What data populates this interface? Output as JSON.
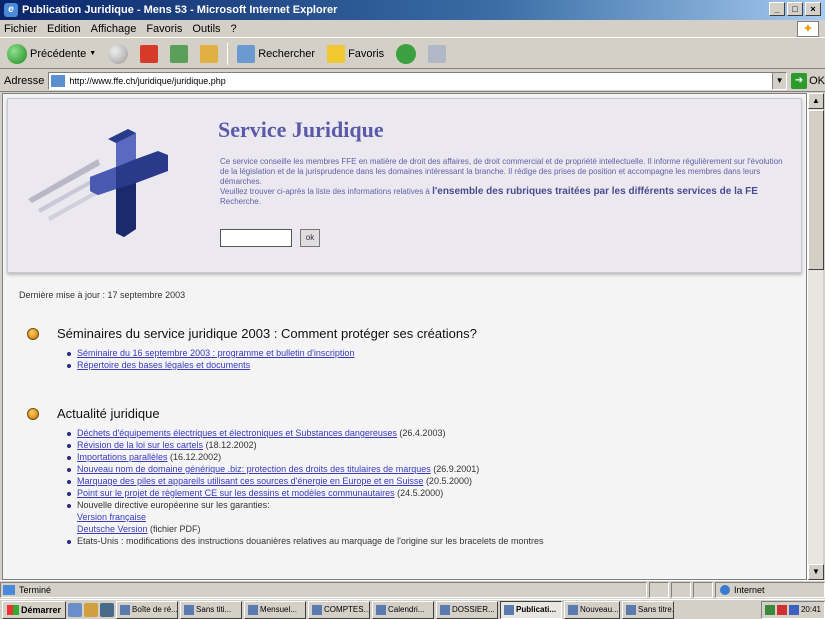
{
  "window": {
    "title": "Publication Juridique - Mens 53 - Microsoft Internet Explorer",
    "buttons": [
      "_",
      "□",
      "×"
    ]
  },
  "menubar": {
    "items": [
      "Fichier",
      "Edition",
      "Affichage",
      "Favoris",
      "Outils",
      "?"
    ]
  },
  "toolbar": {
    "back_label": "Précédente",
    "search_label": "Rechercher",
    "favorites_label": "Favoris"
  },
  "address": {
    "label": "Adresse",
    "url": "http://www.ffe.ch/juridique/juridique.php",
    "go_label": "OK"
  },
  "page": {
    "service_title": "Service Juridique",
    "intro_text": "Ce service conseille les membres FFE en matière de droit des affaires, de droit commercial et de propriété intellectuelle. Il informe régulièrement sur l'évolution de la législation et de la jurisprudence dans les domaines intéressant la branche. Il rédige des prises de position et accompagne les membres dans leurs démarches.",
    "intro_text2": "Veuillez trouver ci-après la liste des informations relatives à",
    "intro_bold": "l'ensemble des rubriques traitées par les différents services de la FE",
    "intro_tail": "Recherche.",
    "search_button": "ok",
    "updated": "Dernière mise à jour : 17 septembre 2003",
    "sections": [
      {
        "title": "Séminaires du service juridique 2003 : Comment protéger ses créations?",
        "links": [
          {
            "text": "Séminaire du 16 septembre 2003 : programme et bulletin d'inscription",
            "suffix": ""
          },
          {
            "text": "Répertoire des bases légales et documents",
            "suffix": ""
          }
        ]
      },
      {
        "title": "Actualité juridique",
        "links": [
          {
            "text": "Déchets d'équipements électriques et électroniques et Substances dangereuses",
            "suffix": " (26.4.2003)"
          },
          {
            "text": "Révision de la loi sur les cartels",
            "suffix": " (18.12.2002)"
          },
          {
            "text": "Importations parallèles",
            "suffix": " (16.12.2002)"
          },
          {
            "text": "Nouveau nom de domaine générique .biz: protection des droits des titulaires de marques",
            "suffix": " (26.9.2001)"
          },
          {
            "text": "Marquage des piles et appareils utilisant ces sources d'énergie en Europe et en Suisse",
            "suffix": " (20.5.2000)"
          },
          {
            "text": "Point sur le projet de règlement CE sur les dessins et modèles communautaires",
            "suffix": " (24.5.2000)"
          }
        ],
        "text_items": [
          {
            "text": "Nouvelle directive européenne sur les garanties:",
            "sublinks": [
              "Version française",
              "Deutsche Version"
            ],
            "sublink_suffix": " (fichier PDF)"
          },
          {
            "text": "Etats-Unis : modifications des instructions douanières relatives au marquage de l'origine sur les bracelets de montres",
            "sublinks": [],
            "sublink_suffix": ""
          }
        ]
      }
    ]
  },
  "statusbar": {
    "text": "Terminé",
    "zone": "Internet"
  },
  "taskbar": {
    "start_label": "Démarrer",
    "tasks": [
      "Boîte de ré...",
      "Sans titi...",
      "Mensuel...",
      "COMPTES...",
      "Calendri...",
      "DOSSIER...",
      "Publicati...",
      "Nouveau...",
      "Sans titre..."
    ],
    "active_index": 6,
    "clock": "20:41"
  }
}
